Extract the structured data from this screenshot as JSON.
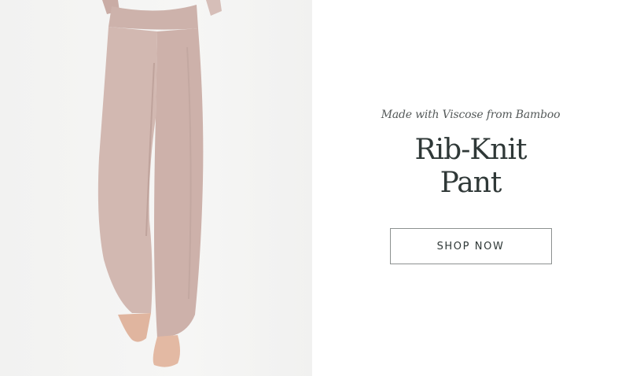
{
  "hero": {
    "image_label": "pants-photo"
  },
  "promo": {
    "eyebrow": "Made with Viscose from Bamboo",
    "title_line1": "Rib-Knit",
    "title_line2": "Pant",
    "cta_label": "SHOP NOW"
  },
  "colors": {
    "pant": "#d2b8b1",
    "skin": "#e3b9a3",
    "text": "#2f3837",
    "button_border": "#8c9190"
  }
}
